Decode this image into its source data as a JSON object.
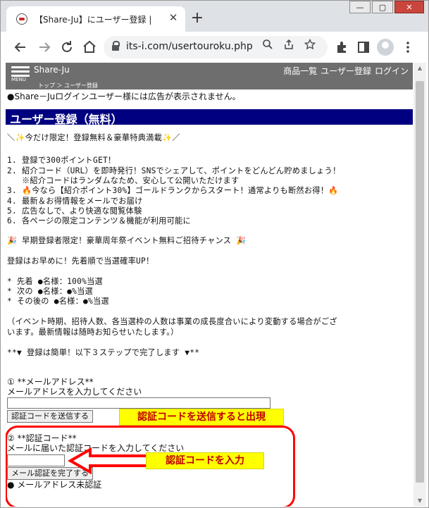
{
  "browser": {
    "tab_title": "【Share-Ju】にユーザー登録 |",
    "tab_close": "✕",
    "new_tab": "+",
    "url": "its-i.com/usertouroku.php",
    "window_buttons": [
      "—",
      "▢",
      "✕"
    ],
    "icons": [
      "back-arrow-icon",
      "forward-arrow-icon",
      "reload-icon",
      "home-icon",
      "lock-icon",
      "zoom-icon",
      "share-icon",
      "star-icon",
      "extensions-icon",
      "sidepanel-icon",
      "profile-icon",
      "kebab-menu-icon"
    ]
  },
  "site": {
    "menu_label": "MENU",
    "brand": "Share-Ju",
    "breadcrumb": "トップ ＞ ユーザー登録",
    "nav": [
      "商品一覧",
      "ユーザー登録",
      "ログイン"
    ]
  },
  "content": {
    "notice": "●Share－Juログインユーザー様には広告が表示されません。",
    "heading": "ユーザー登録（無料）",
    "lines": [
      "＼✨今だけ限定！登録無料＆豪華特典満載✨／",
      "1. 登録で300ポイントGET！",
      "2. 紹介コード（URL）を即時発行！SNSでシェアして、ポイントをどんどん貯めましょう！",
      "   ※紹介コードはランダムなため、安心して公開いただけます",
      "3. 🔥今なら【紹介ポイント30%】ゴールドランクからスタート！通常よりも断然お得！🔥",
      "4. 最新＆お得情報をメールでお届け",
      "5. 広告なしで、より快適な閲覧体験",
      "6. 各ページの限定コンテンツ＆機能が利用可能に",
      "🎉 早期登録者限定！豪華周年祭イベント無料ご招待チャンス 🎉",
      "登録はお早めに！先着順で当選確率UP！",
      "* 先着 ●名様：100%当選",
      "* 次の ●名様：●%当選",
      "* その後の ●名様：●%当選",
      "（イベント時期、招待人数、各当選枠の人数は事業の成長度合いにより変動する場合がござ",
      "います。最新情報は随時お知らせいたします。）",
      "**▼ 登録は簡単！以下３ステップで完了します ▼**"
    ],
    "step1_title": "① **メールアドレス**",
    "step1_hint": "メールアドレスを入力してください",
    "send_code_button": "認証コードを送信する",
    "step2_title": "② **認証コード**",
    "step2_hint": "メールに届いた認証コードを入力してください",
    "verify_button": "メール認証を完了する",
    "status": "● メールアドレス未認証"
  },
  "annotations": {
    "callout_appear": "認証コードを送信すると出現",
    "callout_enter": "認証コードを入力",
    "highlight_color": "#ffff00",
    "annotation_color": "#ff0000"
  }
}
